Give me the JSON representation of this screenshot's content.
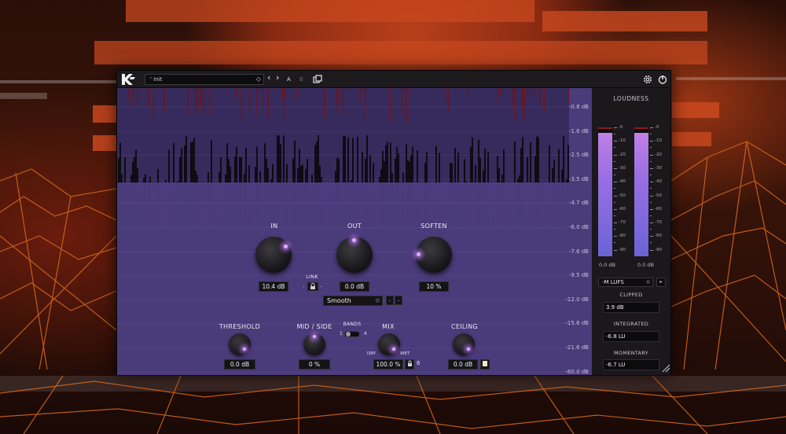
{
  "header": {
    "preset_name": "Init",
    "preset_marker": "'",
    "nav_prev": "‹",
    "nav_next": "›",
    "ab_a": "A",
    "ab_b": "B",
    "dropdown_arrow": "◇"
  },
  "display": {
    "scale_labels": [
      "-0.8 dB",
      "-1.6 dB",
      "-2.5 dB",
      "-3.5 dB",
      "-4.7 dB",
      "-6.0 dB",
      "-7.6 dB",
      "-9.5 dB",
      "-12.0 dB",
      "-15.6 dB",
      "-21.6 dB",
      "-60.0 dB"
    ]
  },
  "controls": {
    "in": {
      "label": "IN",
      "value": "10.4 dB"
    },
    "out": {
      "label": "OUT",
      "value": "0.0 dB"
    },
    "soften": {
      "label": "SOFTEN",
      "value": "10 %"
    },
    "link": {
      "label": "LINK",
      "minus": "-",
      "plus": "-"
    },
    "mode": {
      "value": "Smooth",
      "btn_minus": "-",
      "btn_plus": "-"
    },
    "threshold": {
      "label": "THRESHOLD",
      "value": "0.0 dB"
    },
    "mid_side": {
      "label": "MID / SIDE",
      "value": "0 %"
    },
    "bands": {
      "label": "BANDS",
      "min": "1",
      "max": "4"
    },
    "mix": {
      "label": "MIX",
      "value": "100.0 %",
      "dry": "DRY",
      "wet": "WET",
      "lock_count": "6"
    },
    "ceiling": {
      "label": "CEILING",
      "value": "0.0 dB"
    }
  },
  "loudness": {
    "title": "LOUDNESS",
    "scale": [
      "-0",
      "-10",
      "-20",
      "-30",
      "-40",
      "-50",
      "-60",
      "-70",
      "-80",
      "-90"
    ],
    "left_value": "0.0 dB",
    "right_value": "0.0 dB",
    "left_level": 0.96,
    "right_level": 0.96,
    "mode": "-M LUFS",
    "mode_btn": "▸",
    "clipped_label": "CLIPPED",
    "clipped_value": "3.9 dB",
    "integrated_label": "INTEGRATED",
    "integrated_value": "-6.8 LU",
    "momentary_label": "MOMENTARY",
    "momentary_value": "-6.7 LU"
  },
  "colors": {
    "accent": "#b77cff",
    "display_bg": "#4a3b7a",
    "peak_red": "#8a1a2a"
  }
}
